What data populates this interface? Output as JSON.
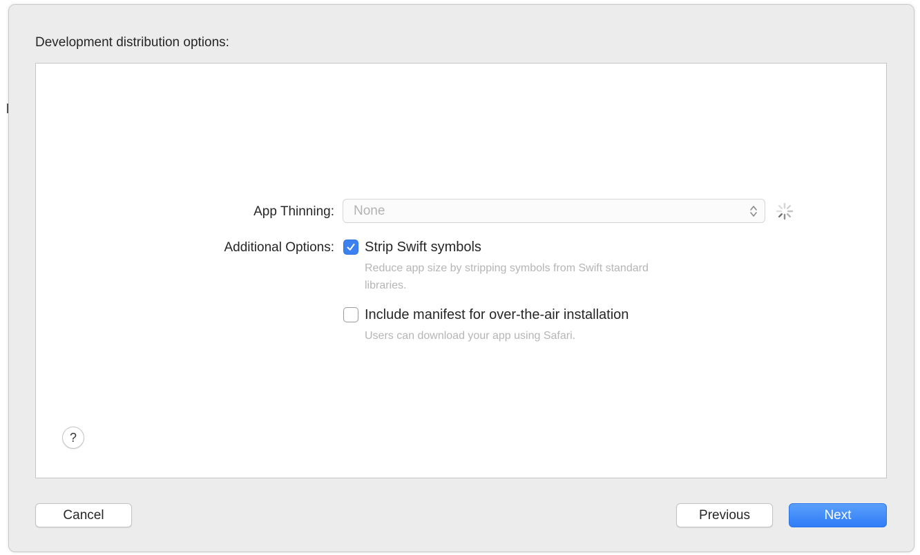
{
  "dialog": {
    "section_title": "Development distribution options:"
  },
  "app_thinning": {
    "label": "App Thinning:",
    "value": "None",
    "arrows_icon": "chevron-up-down-icon",
    "loading_icon": "spinner-icon"
  },
  "additional_options": {
    "label": "Additional Options:",
    "options": [
      {
        "label": "Strip Swift symbols",
        "description": "Reduce app size by stripping symbols from Swift standard libraries.",
        "checked": true
      },
      {
        "label": "Include manifest for over-the-air installation",
        "description": "Users can download your app using Safari.",
        "checked": false
      }
    ]
  },
  "help": {
    "label": "?"
  },
  "buttons": {
    "cancel": "Cancel",
    "previous": "Previous",
    "next": "Next"
  },
  "colors": {
    "accent": "#3b82f0",
    "window_bg": "#ececec",
    "panel_bg": "#ffffff",
    "disabled_text": "#b5b5b5"
  }
}
